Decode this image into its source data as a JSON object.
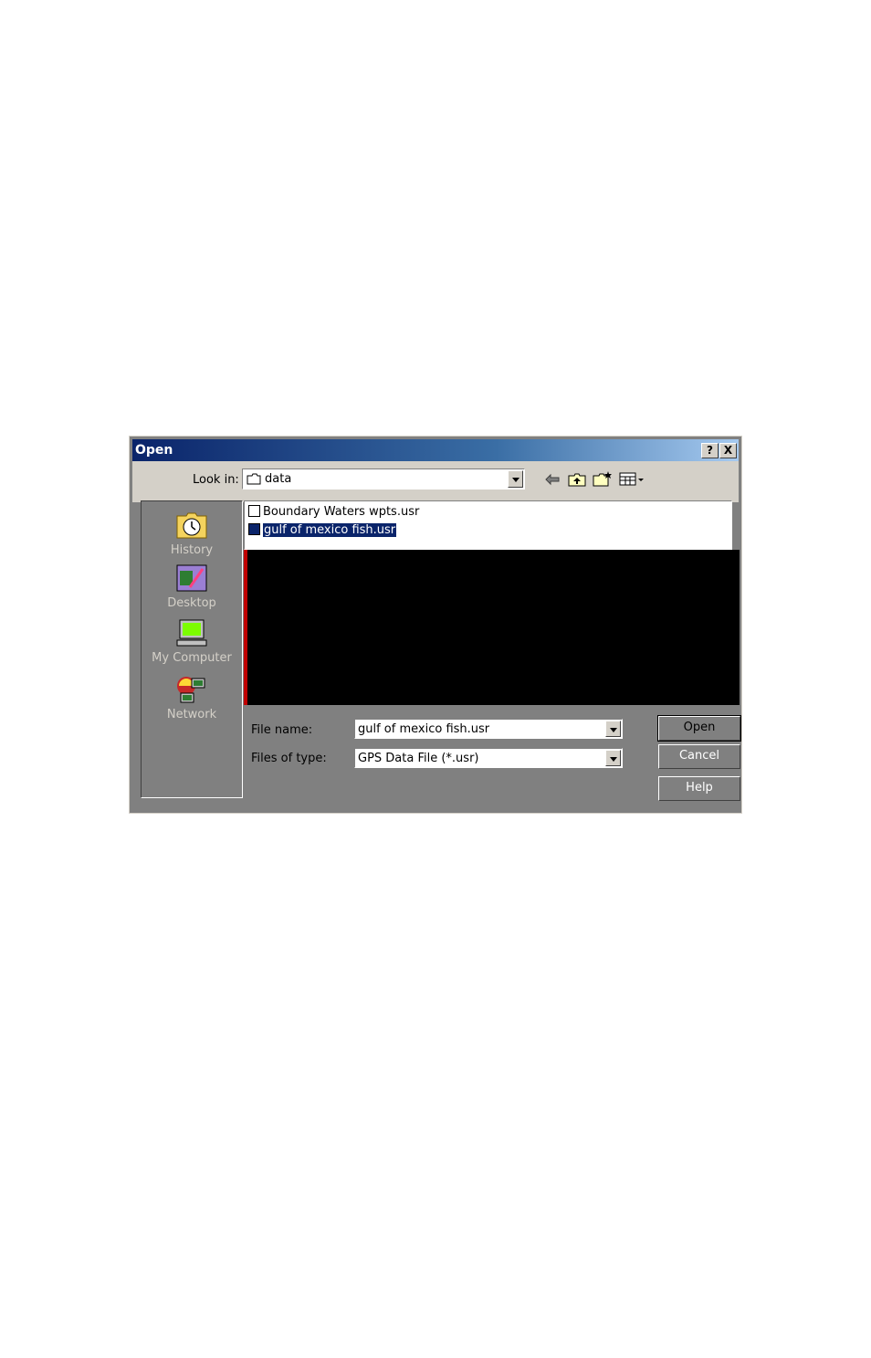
{
  "dialog": {
    "title": "Open",
    "help_button": "?",
    "close_button": "X"
  },
  "toolbar": {
    "look_in_label": "Look in:",
    "look_in_value": "data"
  },
  "places": [
    {
      "label": "History"
    },
    {
      "label": "Desktop"
    },
    {
      "label": "My Computer"
    },
    {
      "label": "Network"
    }
  ],
  "files": [
    {
      "name": "Boundary Waters wpts.usr",
      "selected": false
    },
    {
      "name": "gulf of mexico fish.usr",
      "selected": true
    }
  ],
  "form": {
    "file_name_label": "File name:",
    "file_name_value": "gulf of mexico fish.usr",
    "file_type_label": "Files of type:",
    "file_type_value": "GPS Data File (*.usr)"
  },
  "buttons": {
    "open": "Open",
    "cancel": "Cancel",
    "help": "Help"
  },
  "colors": {
    "title_bar": "#0a246a",
    "selection": "#0a246a",
    "dialog_face": "#d4d0c8"
  }
}
